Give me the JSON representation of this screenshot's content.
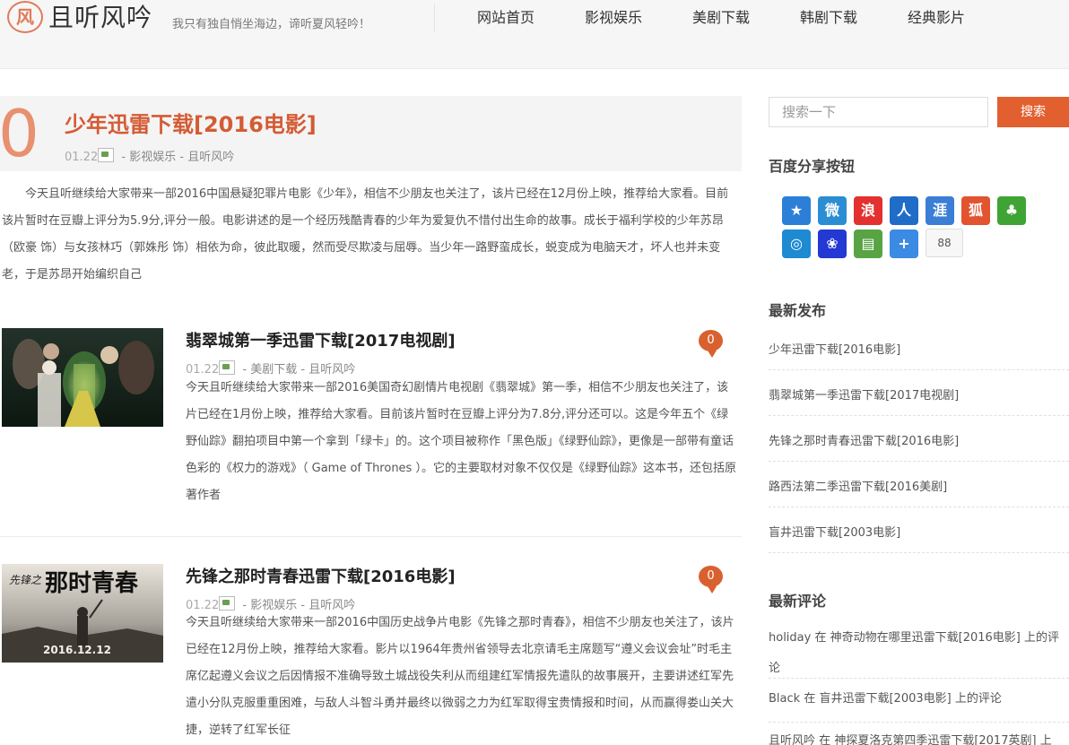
{
  "header": {
    "logo_mark": "风",
    "logo_text": "且听风吟",
    "slogan": "我只有独自悄坐海边，谛听夏风轻吟！",
    "nav": [
      "网站首页",
      "影视娱乐",
      "美剧下载",
      "韩剧下载",
      "经典影片"
    ]
  },
  "featured": {
    "number": "0",
    "title": "少年迅雷下载[2016电影]",
    "date": "01.22",
    "category": "影视娱乐",
    "author": "且听风吟",
    "sep": "-",
    "excerpt": "今天且听继续给大家带来一部2016中国悬疑犯罪片电影《少年》，相信不少朋友也关注了，该片已经在12月份上映，推荐给大家看。目前该片暂时在豆瓣上评分为5.9分,评分一般。电影讲述的是一个经历残酷青春的少年为爱复仇不惜付出生命的故事。成长于福利学校的少年苏昂（欧豪 饰）与女孩林巧（郭姝彤 饰）相依为命，彼此取暖，然而受尽欺凌与屈辱。当少年一路野蛮成长，蜕变成为电脑天才，坏人也并未变老，于是苏昂开始编织自己"
  },
  "posts": [
    {
      "title": "翡翠城第一季迅雷下载[2017电视剧]",
      "date": "01.22",
      "category": "美剧下载",
      "author": "且听风吟",
      "comments": "0",
      "excerpt": "今天且听继续给大家带来一部2016美国奇幻剧情片电视剧《翡翠城》第一季，相信不少朋友也关注了，该片已经在1月份上映，推荐给大家看。目前该片暂时在豆瓣上评分为7.8分,评分还可以。这是今年五个《绿野仙踪》翻拍项目中第一个拿到「绿卡」的。这个项目被称作「黑色版」《绿野仙踪》，更像是一部带有童话色彩的《权力的游戏》（ Game of Thrones ）。它的主要取材对象不仅仅是《绿野仙踪》这本书，还包括原著作者"
    },
    {
      "title": "先锋之那时青春迅雷下载[2016电影]",
      "date": "01.22",
      "category": "影视娱乐",
      "author": "且听风吟",
      "comments": "0",
      "thumb_text": "那时青春",
      "thumb_date": "2016.12.12",
      "excerpt": "今天且听继续给大家带来一部2016中国历史战争片电影《先锋之那时青春》，相信不少朋友也关注了，该片已经在12月份上映，推荐给大家看。影片以1964年贵州省领导去北京请毛主席题写“遵义会议会址”时毛主席亿起遵义会议之后因情报不准确导致土城战役失利从而组建红军情报先遣队的故事展开，主要讲述红军先遣小分队克服重重困难，与敌人斗智斗勇并最终以微弱之力为红军取得宝贵情报和时间，从而赢得娄山关大捷，逆转了红军长征"
    }
  ],
  "sidebar": {
    "search_placeholder": "搜索一下",
    "search_button": "搜索",
    "share_title": "百度分享按钮",
    "share_count": "88",
    "share_icons": [
      {
        "name": "qzone-icon",
        "glyph": "★",
        "color": "#2c7fd6"
      },
      {
        "name": "tencent-weibo-icon",
        "glyph": "微",
        "color": "#2b8ed3"
      },
      {
        "name": "sina-weibo-icon",
        "glyph": "浪",
        "color": "#e3312f"
      },
      {
        "name": "renren-icon",
        "glyph": "人",
        "color": "#1f6dc7"
      },
      {
        "name": "huaban-icon",
        "glyph": "涯",
        "color": "#3a7ed5"
      },
      {
        "name": "sohu-icon",
        "glyph": "狐",
        "color": "#e2532f"
      },
      {
        "name": "kaixin-icon",
        "glyph": "♣",
        "color": "#3fa434"
      },
      {
        "name": "qq-space-icon",
        "glyph": "◎",
        "color": "#1d8ad2"
      },
      {
        "name": "baidu-icon",
        "glyph": "❀",
        "color": "#2438d4"
      },
      {
        "name": "douban-icon",
        "glyph": "▤",
        "color": "#58a344"
      },
      {
        "name": "more-share-icon",
        "glyph": "+",
        "color": "#3b8ae3"
      }
    ],
    "latest_title": "最新发布",
    "latest_posts": [
      "少年迅雷下载[2016电影]",
      "翡翠城第一季迅雷下载[2017电视剧]",
      "先锋之那时青春迅雷下载[2016电影]",
      "路西法第二季迅雷下载[2016美剧]",
      "盲井迅雷下载[2003电影]"
    ],
    "comments_title": "最新评论",
    "comments": [
      {
        "user": "holiday",
        "in": "在",
        "post": "神奇动物在哪里迅雷下载[2016电影]",
        "suffix": "上的评论"
      },
      {
        "user": "Black",
        "in": "在",
        "post": "盲井迅雷下载[2003电影]",
        "suffix": "上的评论"
      },
      {
        "user": "且听风吟",
        "in": "在",
        "post": "神探夏洛克第四季迅雷下载[2017英剧]",
        "suffix": "上"
      }
    ]
  }
}
